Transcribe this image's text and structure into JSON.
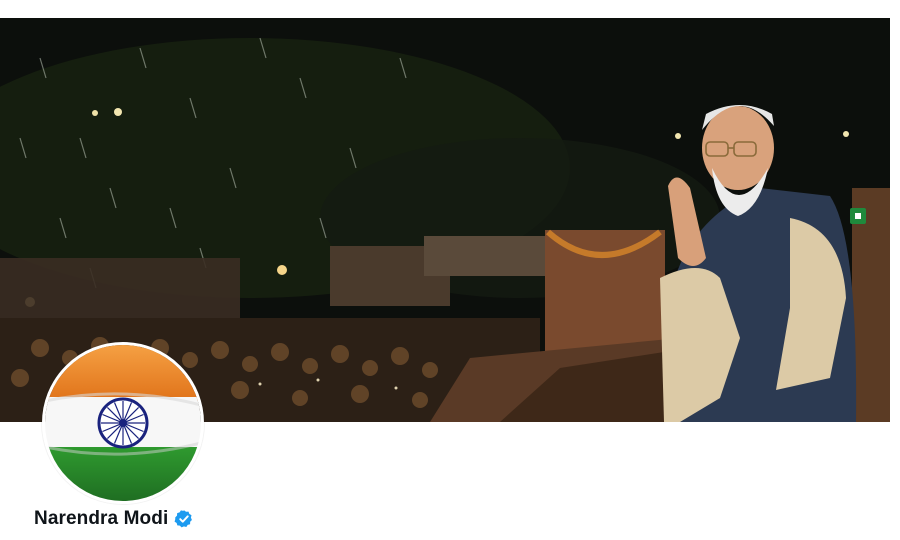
{
  "profile": {
    "display_name": "Narendra Modi",
    "verified": true,
    "verified_badge_color": "#1d9bf0",
    "avatar": {
      "description_icon": "indian-flag-icon",
      "colors": {
        "saffron": "#f08a24",
        "white": "#ffffff",
        "green": "#2f8f2e",
        "chakra": "#1a237e"
      }
    },
    "banner": {
      "icon": "banner-photo",
      "colors": {
        "sky": "#0b0d0b",
        "kurta": "#d8c7a8",
        "vest": "#2c3a52",
        "crowd": "#3a2a18"
      }
    }
  }
}
